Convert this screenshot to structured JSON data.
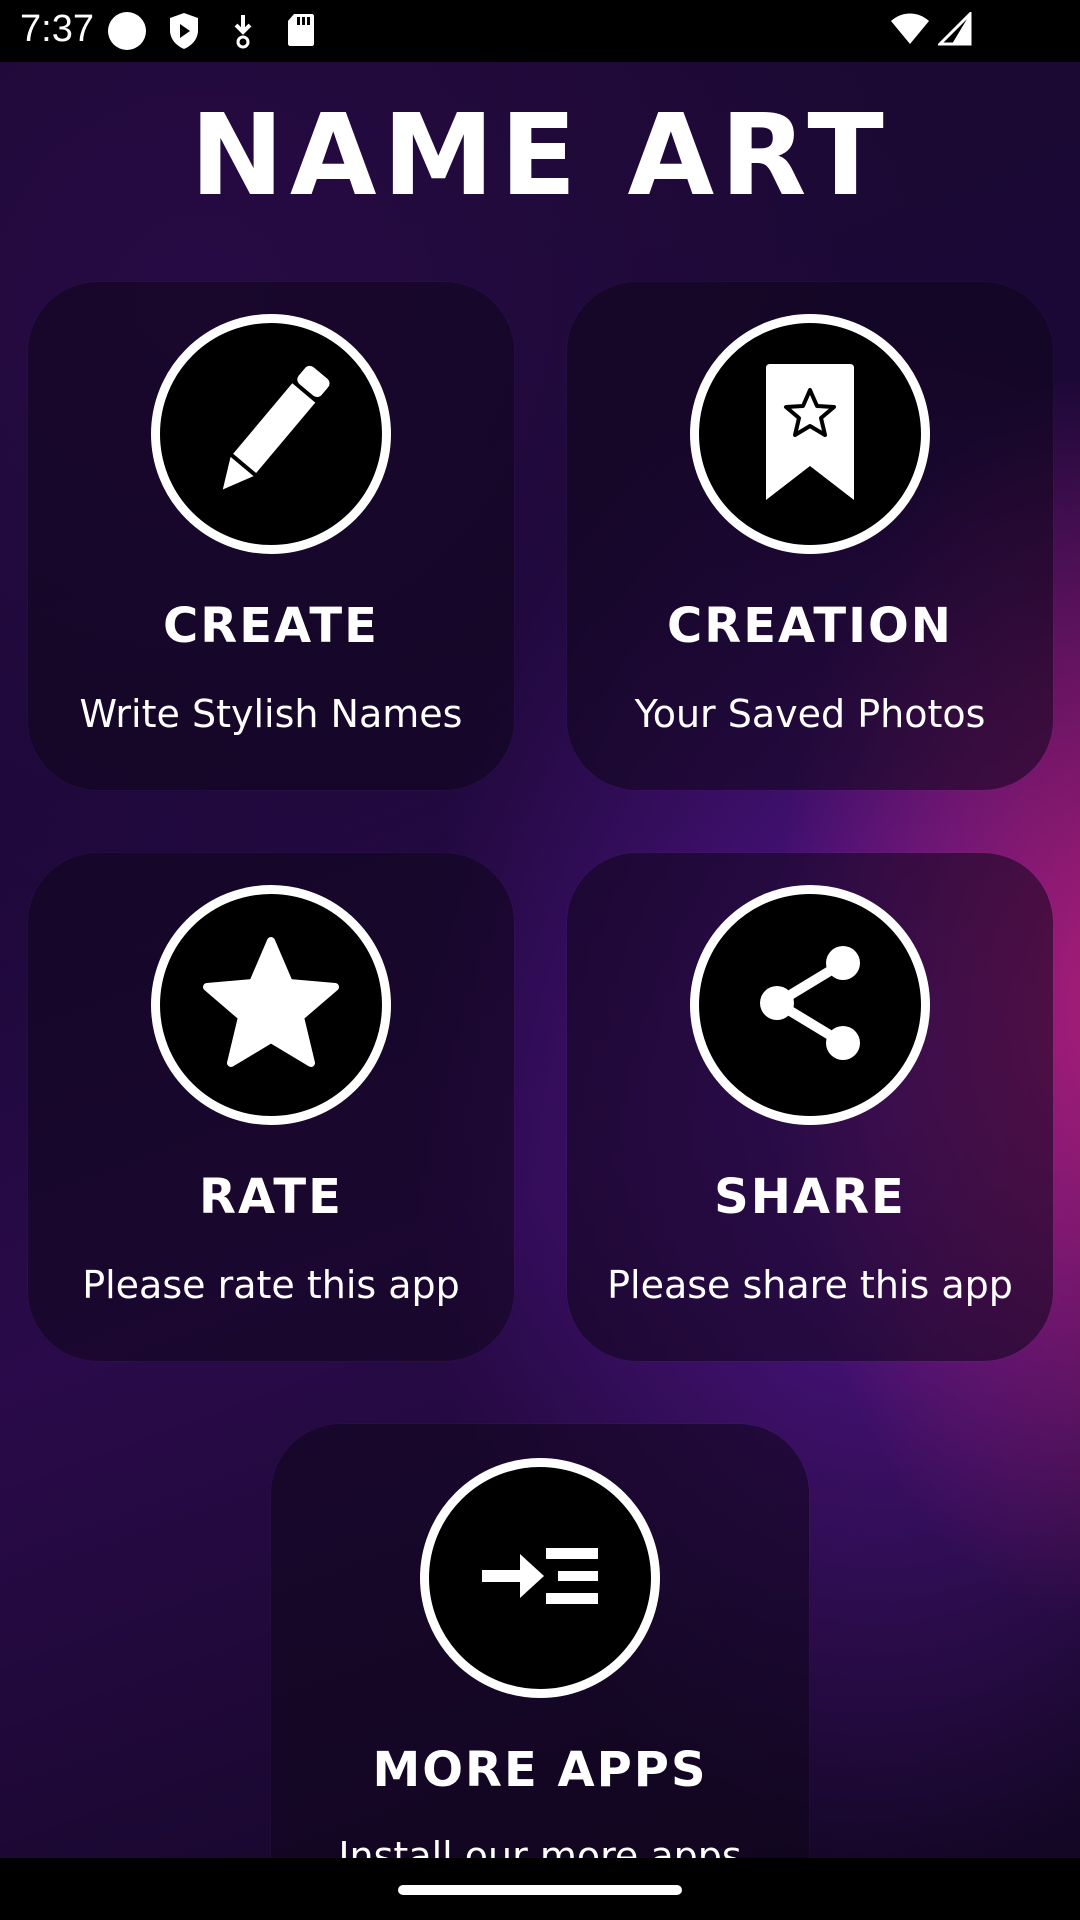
{
  "status_bar": {
    "time": "7:37",
    "icons": [
      "notification-dot-icon",
      "shield-play-icon",
      "download-icon",
      "sd-card-icon",
      "wifi-icon",
      "signal-icon"
    ]
  },
  "app": {
    "title": "NAME ART"
  },
  "menu": [
    {
      "title": "CREATE",
      "subtitle": "Write Stylish Names",
      "icon": "pencil-icon"
    },
    {
      "title": "CREATION",
      "subtitle": "Your Saved Photos",
      "icon": "bookmark-star-icon"
    },
    {
      "title": "RATE",
      "subtitle": "Please rate this app",
      "icon": "star-icon"
    },
    {
      "title": "SHARE",
      "subtitle": "Please share this app",
      "icon": "share-icon"
    },
    {
      "title": "MORE APPS",
      "subtitle": "Install our more apps",
      "icon": "more-apps-icon"
    }
  ],
  "colors": {
    "background": "#1c0838",
    "accent_pink": "#ff2878",
    "accent_purple": "#781ec8",
    "icon_fill": "#000000",
    "icon_ring": "#ffffff"
  }
}
